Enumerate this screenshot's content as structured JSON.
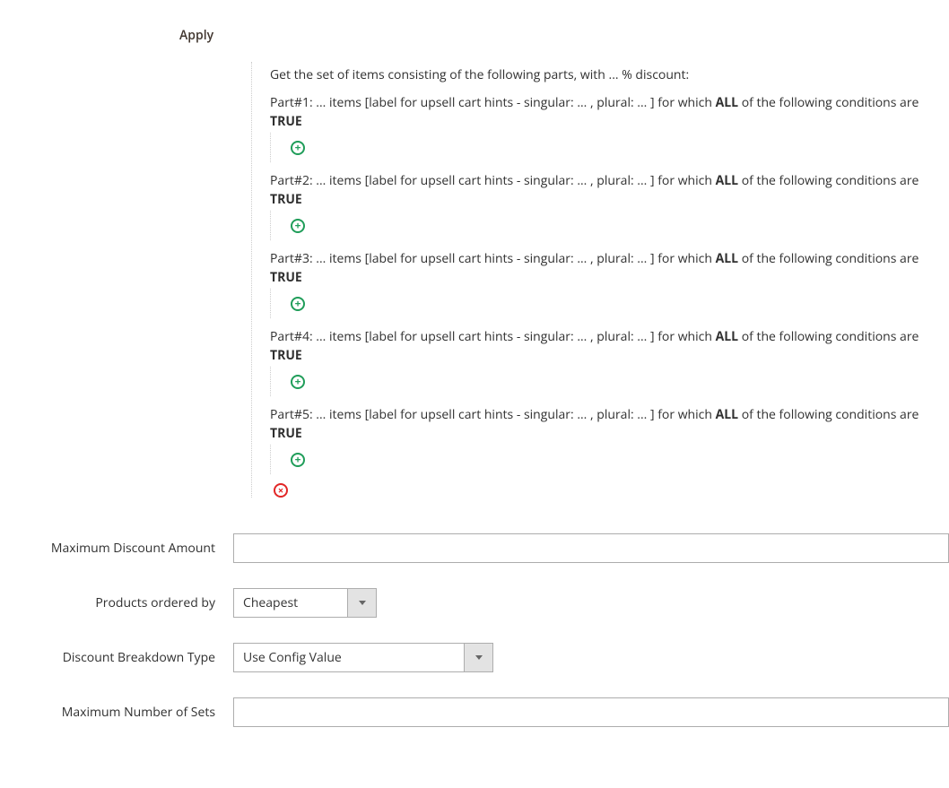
{
  "section_title": "Apply",
  "intro": {
    "prefix": "Get the set of items consisting of the following parts, with ",
    "discount_value": "...",
    "suffix": " % discount:"
  },
  "parts": [
    {
      "label": "Part#1: ",
      "items_value": "...",
      "mid1": " items [label for upsell cart hints - singular: ",
      "sing": "...",
      "mid2": " , plural: ",
      "plur": "...",
      "mid3": " ] for which ",
      "all": "ALL",
      "mid4": "  of the following conditions are ",
      "true": "TRUE"
    },
    {
      "label": "Part#2: ",
      "items_value": "...",
      "mid1": " items [label for upsell cart hints - singular: ",
      "sing": "...",
      "mid2": " , plural: ",
      "plur": "...",
      "mid3": " ] for which ",
      "all": "ALL",
      "mid4": "  of the following conditions are ",
      "true": "TRUE"
    },
    {
      "label": "Part#3: ",
      "items_value": "...",
      "mid1": " items [label for upsell cart hints - singular: ",
      "sing": "...",
      "mid2": " , plural: ",
      "plur": "...",
      "mid3": " ] for which ",
      "all": "ALL",
      "mid4": "  of the following conditions are ",
      "true": "TRUE"
    },
    {
      "label": "Part#4: ",
      "items_value": "...",
      "mid1": " items [label for upsell cart hints - singular: ",
      "sing": "...",
      "mid2": " , plural: ",
      "plur": "...",
      "mid3": " ] for which ",
      "all": "ALL",
      "mid4": "  of the following conditions are ",
      "true": "TRUE"
    },
    {
      "label": "Part#5: ",
      "items_value": "...",
      "mid1": " items [label for upsell cart hints - singular: ",
      "sing": "...",
      "mid2": " , plural: ",
      "plur": "...",
      "mid3": " ] for which ",
      "all": "ALL",
      "mid4": "  of the following conditions are ",
      "true": "TRUE"
    }
  ],
  "icons": {
    "add": "+",
    "remove": "×"
  },
  "fields": {
    "max_discount": {
      "label": "Maximum Discount Amount",
      "value": ""
    },
    "ordered_by": {
      "label": "Products ordered by",
      "value": "Cheapest"
    },
    "breakdown": {
      "label": "Discount Breakdown Type",
      "value": "Use Config Value"
    },
    "max_sets": {
      "label": "Maximum Number of Sets",
      "value": ""
    }
  }
}
